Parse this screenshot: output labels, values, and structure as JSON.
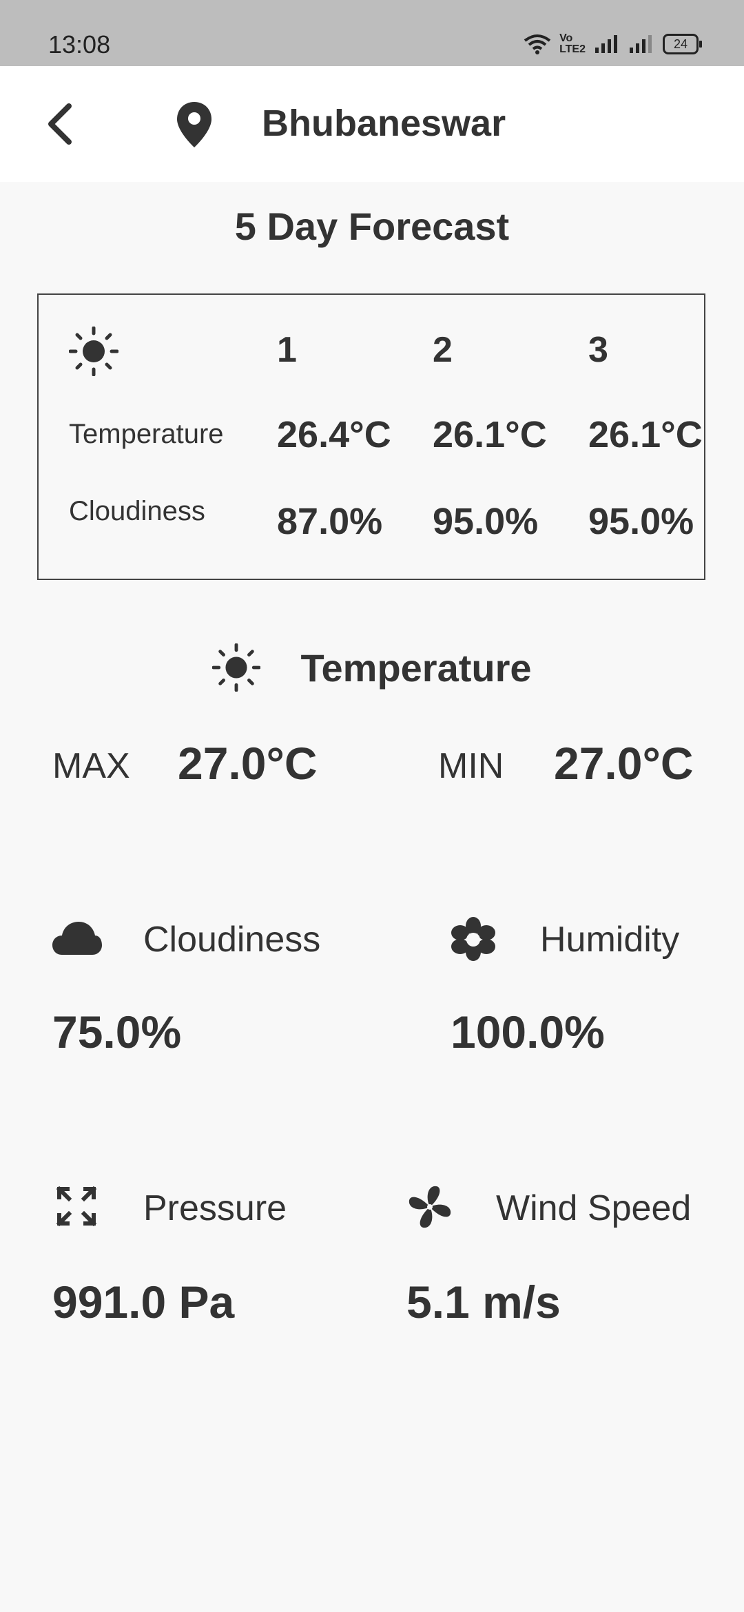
{
  "status_bar": {
    "time": "13:08",
    "network_label_1": "Vo",
    "network_label_2": "LTE2",
    "battery": "24"
  },
  "app_bar": {
    "back_icon": "chevron-left-icon",
    "location_icon": "map-pin-icon",
    "city": "Bhubaneswar"
  },
  "forecast": {
    "title": "5 Day Forecast",
    "header_icon": "sun-icon",
    "days": [
      "1",
      "2",
      "3"
    ],
    "temperature_label": "Temperature",
    "temperatures": [
      "26.4°C",
      "26.1°C",
      "26.1°C"
    ],
    "cloudiness_label": "Cloudiness",
    "cloudiness": [
      "87.0%",
      "95.0%",
      "95.0%"
    ]
  },
  "current": {
    "temperature_title": "Temperature",
    "max_label": "MAX",
    "max_value": "27.0°C",
    "min_label": "MIN",
    "min_value": "27.0°C",
    "cloudiness_label": "Cloudiness",
    "cloudiness_value": "75.0%",
    "humidity_label": "Humidity",
    "humidity_value": "100.0%",
    "pressure_label": "Pressure",
    "pressure_value": "991.0 Pa",
    "wind_label": "Wind Speed",
    "wind_value": "5.1 m/s"
  },
  "colors": {
    "status_bar_bg": "#bdbdbd",
    "app_bar_bg": "#ffffff",
    "page_bg": "#f8f8f8",
    "text": "#333333"
  }
}
